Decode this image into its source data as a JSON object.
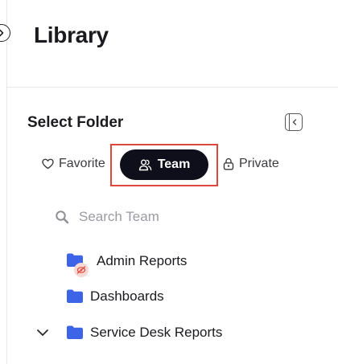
{
  "header": {
    "title": "Library"
  },
  "panel": {
    "title": "Select Folder",
    "tabs": [
      {
        "label": "Favorite",
        "icon": "heart-icon"
      },
      {
        "label": "Team",
        "icon": "users-icon",
        "selected": true
      },
      {
        "label": "Private",
        "icon": "lock-icon"
      }
    ],
    "search": {
      "placeholder": "Search Team",
      "value": ""
    },
    "tree": [
      {
        "label": "Admin Reports",
        "icon": "folder-icon",
        "badge": "hidden-eye-icon"
      },
      {
        "label": "Dashboards",
        "icon": "folder-icon"
      },
      {
        "label": "Service Desk Reports",
        "icon": "folder-icon",
        "expanded": true
      }
    ]
  },
  "colors": {
    "accent_dark": "#0e0f1a",
    "folder_blue": "#3d63e6",
    "highlight_red": "#e0473b",
    "badge_bg": "#f6d9d5"
  }
}
